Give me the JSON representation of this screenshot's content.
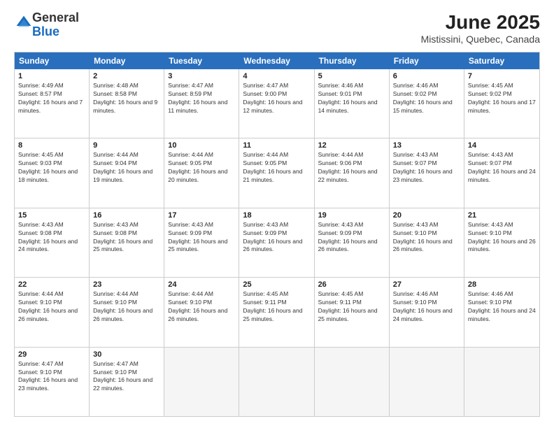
{
  "logo": {
    "general": "General",
    "blue": "Blue"
  },
  "title": "June 2025",
  "subtitle": "Mistissini, Quebec, Canada",
  "header_days": [
    "Sunday",
    "Monday",
    "Tuesday",
    "Wednesday",
    "Thursday",
    "Friday",
    "Saturday"
  ],
  "weeks": [
    [
      {
        "day": "1",
        "info": "Sunrise: 4:49 AM\nSunset: 8:57 PM\nDaylight: 16 hours and 7 minutes."
      },
      {
        "day": "2",
        "info": "Sunrise: 4:48 AM\nSunset: 8:58 PM\nDaylight: 16 hours and 9 minutes."
      },
      {
        "day": "3",
        "info": "Sunrise: 4:47 AM\nSunset: 8:59 PM\nDaylight: 16 hours and 11 minutes."
      },
      {
        "day": "4",
        "info": "Sunrise: 4:47 AM\nSunset: 9:00 PM\nDaylight: 16 hours and 12 minutes."
      },
      {
        "day": "5",
        "info": "Sunrise: 4:46 AM\nSunset: 9:01 PM\nDaylight: 16 hours and 14 minutes."
      },
      {
        "day": "6",
        "info": "Sunrise: 4:46 AM\nSunset: 9:02 PM\nDaylight: 16 hours and 15 minutes."
      },
      {
        "day": "7",
        "info": "Sunrise: 4:45 AM\nSunset: 9:02 PM\nDaylight: 16 hours and 17 minutes."
      }
    ],
    [
      {
        "day": "8",
        "info": "Sunrise: 4:45 AM\nSunset: 9:03 PM\nDaylight: 16 hours and 18 minutes."
      },
      {
        "day": "9",
        "info": "Sunrise: 4:44 AM\nSunset: 9:04 PM\nDaylight: 16 hours and 19 minutes."
      },
      {
        "day": "10",
        "info": "Sunrise: 4:44 AM\nSunset: 9:05 PM\nDaylight: 16 hours and 20 minutes."
      },
      {
        "day": "11",
        "info": "Sunrise: 4:44 AM\nSunset: 9:05 PM\nDaylight: 16 hours and 21 minutes."
      },
      {
        "day": "12",
        "info": "Sunrise: 4:44 AM\nSunset: 9:06 PM\nDaylight: 16 hours and 22 minutes."
      },
      {
        "day": "13",
        "info": "Sunrise: 4:43 AM\nSunset: 9:07 PM\nDaylight: 16 hours and 23 minutes."
      },
      {
        "day": "14",
        "info": "Sunrise: 4:43 AM\nSunset: 9:07 PM\nDaylight: 16 hours and 24 minutes."
      }
    ],
    [
      {
        "day": "15",
        "info": "Sunrise: 4:43 AM\nSunset: 9:08 PM\nDaylight: 16 hours and 24 minutes."
      },
      {
        "day": "16",
        "info": "Sunrise: 4:43 AM\nSunset: 9:08 PM\nDaylight: 16 hours and 25 minutes."
      },
      {
        "day": "17",
        "info": "Sunrise: 4:43 AM\nSunset: 9:09 PM\nDaylight: 16 hours and 25 minutes."
      },
      {
        "day": "18",
        "info": "Sunrise: 4:43 AM\nSunset: 9:09 PM\nDaylight: 16 hours and 26 minutes."
      },
      {
        "day": "19",
        "info": "Sunrise: 4:43 AM\nSunset: 9:09 PM\nDaylight: 16 hours and 26 minutes."
      },
      {
        "day": "20",
        "info": "Sunrise: 4:43 AM\nSunset: 9:10 PM\nDaylight: 16 hours and 26 minutes."
      },
      {
        "day": "21",
        "info": "Sunrise: 4:43 AM\nSunset: 9:10 PM\nDaylight: 16 hours and 26 minutes."
      }
    ],
    [
      {
        "day": "22",
        "info": "Sunrise: 4:44 AM\nSunset: 9:10 PM\nDaylight: 16 hours and 26 minutes."
      },
      {
        "day": "23",
        "info": "Sunrise: 4:44 AM\nSunset: 9:10 PM\nDaylight: 16 hours and 26 minutes."
      },
      {
        "day": "24",
        "info": "Sunrise: 4:44 AM\nSunset: 9:10 PM\nDaylight: 16 hours and 26 minutes."
      },
      {
        "day": "25",
        "info": "Sunrise: 4:45 AM\nSunset: 9:11 PM\nDaylight: 16 hours and 25 minutes."
      },
      {
        "day": "26",
        "info": "Sunrise: 4:45 AM\nSunset: 9:11 PM\nDaylight: 16 hours and 25 minutes."
      },
      {
        "day": "27",
        "info": "Sunrise: 4:46 AM\nSunset: 9:10 PM\nDaylight: 16 hours and 24 minutes."
      },
      {
        "day": "28",
        "info": "Sunrise: 4:46 AM\nSunset: 9:10 PM\nDaylight: 16 hours and 24 minutes."
      }
    ],
    [
      {
        "day": "29",
        "info": "Sunrise: 4:47 AM\nSunset: 9:10 PM\nDaylight: 16 hours and 23 minutes."
      },
      {
        "day": "30",
        "info": "Sunrise: 4:47 AM\nSunset: 9:10 PM\nDaylight: 16 hours and 22 minutes."
      },
      {
        "day": "",
        "info": ""
      },
      {
        "day": "",
        "info": ""
      },
      {
        "day": "",
        "info": ""
      },
      {
        "day": "",
        "info": ""
      },
      {
        "day": "",
        "info": ""
      }
    ]
  ]
}
